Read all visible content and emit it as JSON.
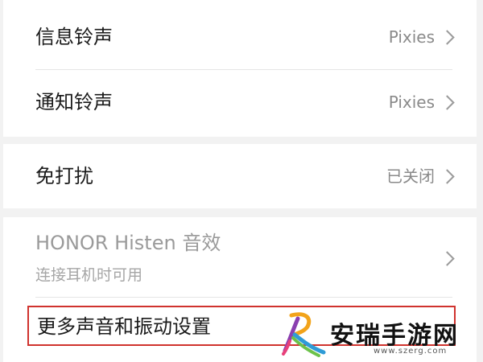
{
  "settings": {
    "message_ringtone": {
      "label": "信息铃声",
      "value": "Pixies"
    },
    "notification_ringtone": {
      "label": "通知铃声",
      "value": "Pixies"
    },
    "do_not_disturb": {
      "label": "免打扰",
      "value": "已关闭"
    },
    "honor_histen": {
      "label": "HONOR Histen 音效",
      "subtitle": "连接耳机时可用"
    },
    "more_sound_vibration": {
      "label": "更多声音和振动设置"
    }
  },
  "watermark": {
    "brand": "安瑞手游网",
    "url": "www.szerg.com"
  },
  "colors": {
    "highlight_border": "#d0332e",
    "muted_text": "#9a9a9a"
  }
}
